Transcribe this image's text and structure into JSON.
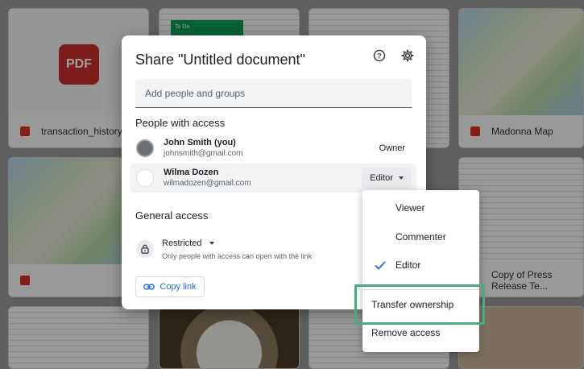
{
  "background": {
    "files": [
      {
        "name": "transaction_history.pdf",
        "type": "pdf",
        "badge": "PDF"
      },
      {
        "name": "To Do",
        "type": "sheet"
      },
      {
        "name": "Madonna Map",
        "type": "map"
      },
      {
        "name": "Copy of Press Release Te...",
        "type": "doc"
      }
    ]
  },
  "dialog": {
    "title": "Share \"Untitled document\"",
    "help_icon": "help-circle-icon",
    "settings_icon": "gear-icon",
    "add_people_placeholder": "Add people and groups",
    "people_section_label": "People with access",
    "people": [
      {
        "name": "John Smith (you)",
        "email": "johnsmith@gmail.com",
        "role": "Owner"
      },
      {
        "name": "Wilma Dozen",
        "email": "wilmadozen@gmail.com",
        "role": "Editor"
      }
    ],
    "general_access_label": "General access",
    "access_level": "Restricted",
    "access_description": "Only people with access can open with the link",
    "copy_link_label": "Copy link"
  },
  "role_menu": {
    "items": [
      {
        "label": "Viewer",
        "checked": false
      },
      {
        "label": "Commenter",
        "checked": false
      },
      {
        "label": "Editor",
        "checked": true
      }
    ],
    "transfer_label": "Transfer ownership",
    "remove_label": "Remove access"
  },
  "colors": {
    "accent": "#1a73e8",
    "highlight_box": "#4aab7e"
  }
}
